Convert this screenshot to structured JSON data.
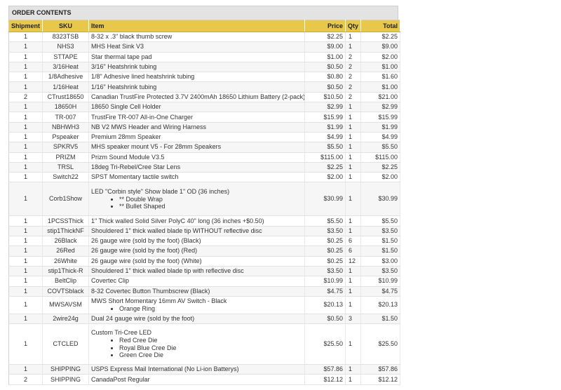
{
  "panel": {
    "title": "ORDER CONTENTS"
  },
  "table": {
    "headers": {
      "shipment": "Shipment",
      "sku": "SKU",
      "item": "Item",
      "price": "Price",
      "qty": "Qty",
      "total": "Total"
    },
    "rows": [
      {
        "shipment": "1",
        "sku": "8323TSB",
        "item": "8-32 x .3\" black thumb screw",
        "price": "$2.25",
        "qty": "1",
        "total": "$2.25"
      },
      {
        "shipment": "1",
        "sku": "NHS3",
        "item": "MHS Heat Sink V3",
        "price": "$9.00",
        "qty": "1",
        "total": "$9.00"
      },
      {
        "shipment": "1",
        "sku": "STTAPE",
        "item": "Star thermal tape pad",
        "price": "$1.00",
        "qty": "2",
        "total": "$2.00"
      },
      {
        "shipment": "1",
        "sku": "3/16Heat",
        "item": "3/16\" Heatshrink tubing",
        "price": "$0.50",
        "qty": "2",
        "total": "$1.00"
      },
      {
        "shipment": "1",
        "sku": "1/8Adhesive",
        "item": "1/8\" Adhesive lined heatshrink tubing",
        "price": "$0.80",
        "qty": "2",
        "total": "$1.60"
      },
      {
        "shipment": "1",
        "sku": "1/16Heat",
        "item": "1/16\" Heatshrink tubing",
        "price": "$0.50",
        "qty": "2",
        "total": "$1.00"
      },
      {
        "shipment": "2",
        "sku": "CTrust18650",
        "item": "Canadian TrustFire Protected 3.7V 2400mAh 18650 Lithium Battery (2-pack)",
        "price": "$10.50",
        "qty": "2",
        "total": "$21.00"
      },
      {
        "shipment": "1",
        "sku": "18650H",
        "item": "18650 Single Cell Holder",
        "price": "$2.99",
        "qty": "1",
        "total": "$2.99"
      },
      {
        "shipment": "1",
        "sku": "TR-007",
        "item": "TrustFire TR-007 All-in-One Charger",
        "price": "$15.99",
        "qty": "1",
        "total": "$15.99"
      },
      {
        "shipment": "1",
        "sku": "NBHWH3",
        "item": "NB V2 MWS Header and Wiring Harness",
        "price": "$1.99",
        "qty": "1",
        "total": "$1.99"
      },
      {
        "shipment": "1",
        "sku": "Pspeaker",
        "item": "Premium 28mm Speaker",
        "price": "$4.99",
        "qty": "1",
        "total": "$4.99"
      },
      {
        "shipment": "1",
        "sku": "SPKRV5",
        "item": "MHS speaker mount V5 - For 28mm Speakers",
        "price": "$5.50",
        "qty": "1",
        "total": "$5.50"
      },
      {
        "shipment": "1",
        "sku": "PRIZM",
        "item": "Prizm Sound Module V3.5",
        "price": "$115.00",
        "qty": "1",
        "total": "$115.00"
      },
      {
        "shipment": "1",
        "sku": "TRSL",
        "item": "18deg Tri-Rebel/Cree Star Lens",
        "price": "$2.25",
        "qty": "1",
        "total": "$2.25"
      },
      {
        "shipment": "1",
        "sku": "Switch22",
        "item": "SPST Momentary tactile switch",
        "price": "$2.00",
        "qty": "1",
        "total": "$2.00"
      },
      {
        "shipment": "1",
        "sku": "Corb1Show",
        "item": "LED \"Corbin style\" Show blade 1\" OD (36 inches)",
        "options": [
          "** Double Wrap",
          "** Bullet Shaped"
        ],
        "price": "$30.99",
        "qty": "1",
        "total": "$30.99"
      },
      {
        "shipment": "1",
        "sku": "1PCSSThick",
        "item": "1\" Thick walled Solid Silver PolyC 40\" long (36 inches +$0.50)",
        "price": "$5.50",
        "qty": "1",
        "total": "$5.50"
      },
      {
        "shipment": "1",
        "sku": "stip1ThickNF",
        "item": "Shouldered 1\" thick walled blade tip WITHOUT reflective disc",
        "price": "$3.50",
        "qty": "1",
        "total": "$3.50"
      },
      {
        "shipment": "1",
        "sku": "26Black",
        "item": "26 gauge wire (sold by the foot) (Black)",
        "price": "$0.25",
        "qty": "6",
        "total": "$1.50"
      },
      {
        "shipment": "1",
        "sku": "26Red",
        "item": "26 gauge wire (sold by the foot) (Red)",
        "price": "$0.25",
        "qty": "6",
        "total": "$1.50"
      },
      {
        "shipment": "1",
        "sku": "26White",
        "item": "26 gauge wire (sold by the foot) (White)",
        "price": "$0.25",
        "qty": "12",
        "total": "$3.00"
      },
      {
        "shipment": "1",
        "sku": "stip1Thick-R",
        "item": "Shouldered 1\" thick walled blade tip with reflective disc",
        "price": "$3.50",
        "qty": "1",
        "total": "$3.50"
      },
      {
        "shipment": "1",
        "sku": "BeltClip",
        "item": "Covertec Clip",
        "price": "$10.99",
        "qty": "1",
        "total": "$10.99"
      },
      {
        "shipment": "1",
        "sku": "COVTSblack",
        "item": "8-32 Covertec Button Thumbscrew (Black)",
        "price": "$4.75",
        "qty": "1",
        "total": "$4.75"
      },
      {
        "shipment": "1",
        "sku": "MWSAVSM",
        "item": "MWS Short Momentary 16mm AV Switch - Black",
        "options": [
          "Orange Ring"
        ],
        "price": "$20.13",
        "qty": "1",
        "total": "$20.13"
      },
      {
        "shipment": "1",
        "sku": "2wire24g",
        "item": "Dual 24 gauge wire (sold by the foot)",
        "price": "$0.50",
        "qty": "3",
        "total": "$1.50"
      },
      {
        "shipment": "1",
        "sku": "CTCLED",
        "item": "Custom Tri-Cree LED",
        "options": [
          "Red Cree Die",
          "Royal Blue Cree Die",
          "Green Cree Die"
        ],
        "price": "$25.50",
        "qty": "1",
        "total": "$25.50"
      },
      {
        "shipment": "1",
        "sku": "SHIPPING",
        "item": "USPS Express Mail International (No Li-ion Batterys)",
        "price": "$57.86",
        "qty": "1",
        "total": "$57.86"
      },
      {
        "shipment": "2",
        "sku": "SHIPPING",
        "item": "CanadaPost Regular",
        "price": "$12.12",
        "qty": "1",
        "total": "$12.12"
      }
    ]
  }
}
